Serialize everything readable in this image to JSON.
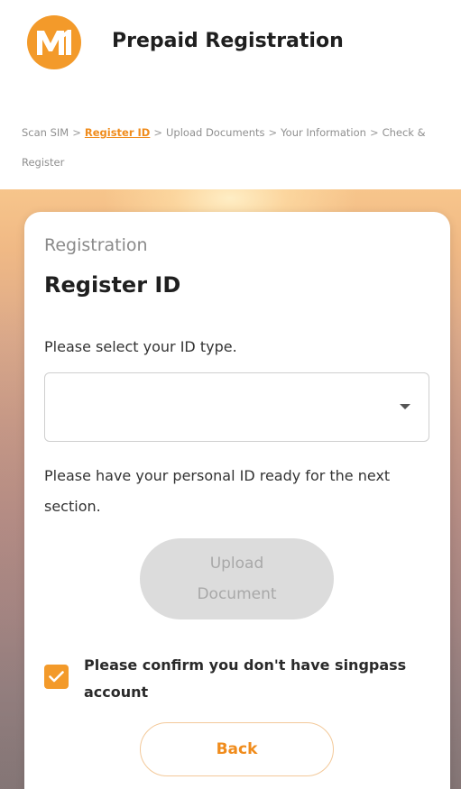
{
  "header": {
    "logo_text": "M1",
    "title": "Prepaid Registration"
  },
  "breadcrumb": {
    "items": [
      {
        "label": "Scan SIM",
        "active": false
      },
      {
        "label": "Register ID",
        "active": true
      },
      {
        "label": "Upload Documents",
        "active": false
      },
      {
        "label": "Your Information",
        "active": false
      },
      {
        "label": "Check & Register",
        "active": false
      }
    ],
    "separator": ">"
  },
  "card": {
    "eyebrow": "Registration",
    "title": "Register ID",
    "prompt": "Please select your ID type.",
    "id_type_select": {
      "selected_value": ""
    },
    "note": "Please have your personal ID ready for the next section.",
    "upload_button_label": "Upload Document",
    "confirm_checkbox": {
      "checked": true,
      "label": "Please confirm you don't have singpass account"
    },
    "back_button_label": "Back"
  },
  "colors": {
    "brand_orange": "#f39a2a",
    "link_orange": "#f08c1c",
    "disabled_button": "#dcdcdc",
    "text_dark": "#1f1f1f",
    "text_muted": "#8a8a8a"
  }
}
